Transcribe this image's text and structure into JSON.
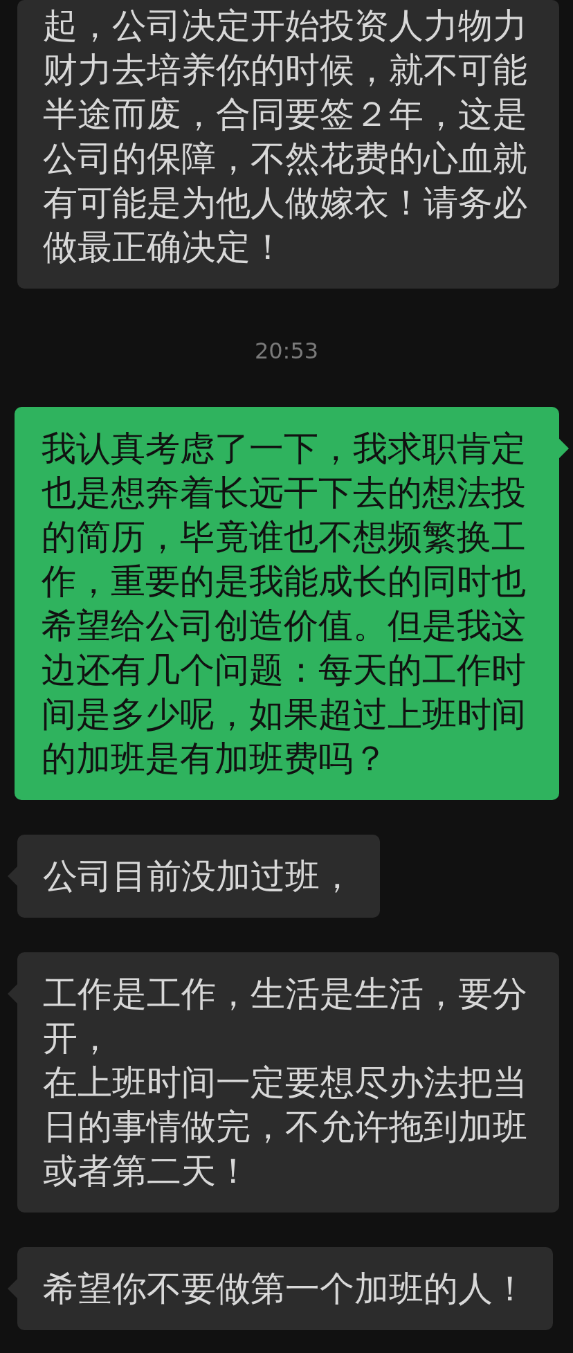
{
  "messages": [
    {
      "kind": "incoming",
      "paragraphs": [
        "起，公司决定开始投资人力物力财力去培养你的时候，就不可能半途而废，合同要签２年，这是公司的保障，不然花费的心血就有可能是为他人做嫁衣！请务必做最正确决定！"
      ]
    },
    {
      "kind": "timestamp",
      "paragraphs": [
        "20:53"
      ]
    },
    {
      "kind": "outgoing",
      "paragraphs": [
        "我认真考虑了一下，我求职肯定也是想奔着长远干下去的想法投的简历，毕竟谁也不想频繁换工作，重要的是我能成长的同时也希望给公司创造价值。但是我这边还有几个问题：每天的工作时间是多少呢，如果超过上班时间的加班是有加班费吗？"
      ]
    },
    {
      "kind": "incoming",
      "paragraphs": [
        "公司目前没加过班，"
      ]
    },
    {
      "kind": "incoming",
      "paragraphs": [
        "工作是工作，生活是生活，要分开，",
        "在上班时间一定要想尽办法把当日的事情做完，不允许拖到加班或者第二天！"
      ]
    },
    {
      "kind": "incoming",
      "paragraphs": [
        "希望你不要做第一个加班的人！"
      ]
    }
  ]
}
